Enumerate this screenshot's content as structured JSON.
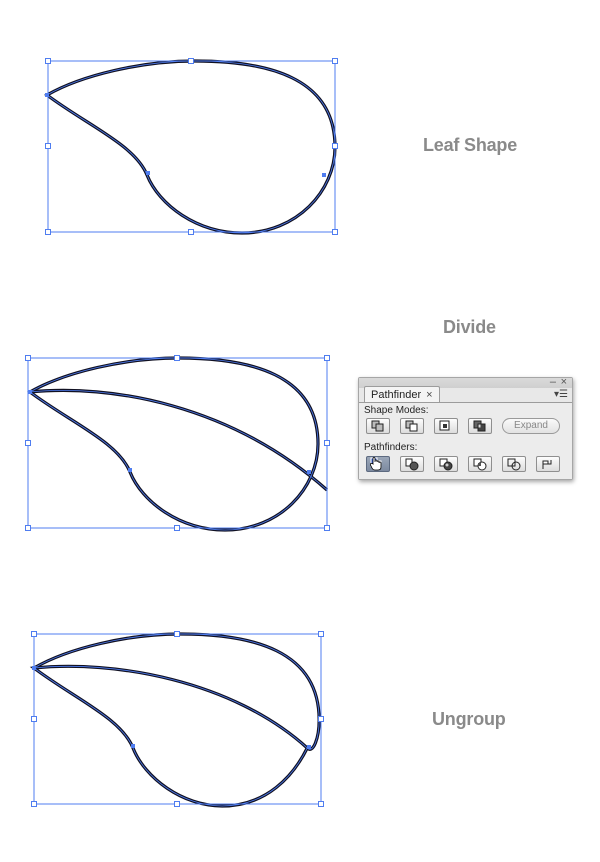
{
  "steps": [
    {
      "label": "Leaf Shape"
    },
    {
      "label": "Divide"
    },
    {
      "label": "Ungroup"
    }
  ],
  "pathfinder_panel": {
    "tab_title": "Pathfinder",
    "close_glyph": "×",
    "minimize_glyph": "‒",
    "panel_close_glyph": "×",
    "menu_glyph": "▾☰",
    "shape_modes_label": "Shape Modes:",
    "pathfinders_label": "Pathfinders:",
    "expand_label": "Expand",
    "shape_mode_buttons": [
      "unite-icon",
      "minus-front-icon",
      "intersect-icon",
      "exclude-icon"
    ],
    "pathfinder_buttons": [
      "divide-icon",
      "trim-icon",
      "merge-icon",
      "crop-icon",
      "outline-icon",
      "minus-back-icon"
    ],
    "active_button": "divide-icon"
  },
  "colors": {
    "label_gray": "#8a8a8a",
    "selection_blue": "#4f7df0",
    "stroke": "#111122"
  }
}
